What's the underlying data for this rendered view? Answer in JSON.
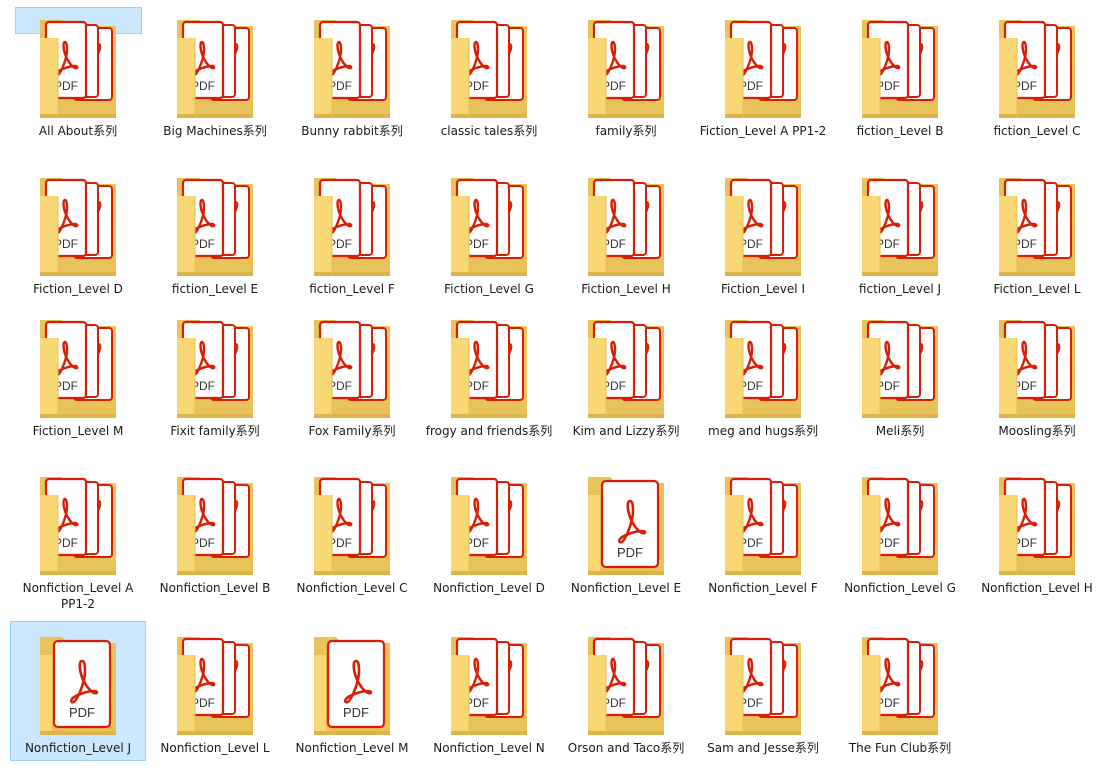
{
  "accent_color": "#cce8ff",
  "accent_border": "#99d1ff",
  "rows": [
    [
      {
        "label": "All About系列",
        "icon": "folder-pdf-icon",
        "state": "partial"
      },
      {
        "label": "Big Machines系列",
        "icon": "folder-pdf-icon"
      },
      {
        "label": "Bunny rabbit系列",
        "icon": "folder-pdf-icon"
      },
      {
        "label": "classic tales系列",
        "icon": "folder-pdf-icon"
      },
      {
        "label": "family系列",
        "icon": "folder-pdf-icon"
      },
      {
        "label": "Fiction_Level A PP1-2",
        "icon": "folder-pdf-icon"
      },
      {
        "label": "fiction_Level B",
        "icon": "folder-pdf-icon"
      },
      {
        "label": "fiction_Level C",
        "icon": "folder-pdf-icon"
      }
    ],
    [
      {
        "label": "Fiction_Level D",
        "icon": "folder-pdf-icon"
      },
      {
        "label": "fiction_Level E",
        "icon": "folder-pdf-icon"
      },
      {
        "label": "fiction_Level F",
        "icon": "folder-pdf-icon"
      },
      {
        "label": "Fiction_Level G",
        "icon": "folder-pdf-icon"
      },
      {
        "label": "Fiction_Level H",
        "icon": "folder-pdf-icon"
      },
      {
        "label": "Fiction_Level I",
        "icon": "folder-pdf-icon"
      },
      {
        "label": "fiction_Level J",
        "icon": "folder-pdf-icon"
      },
      {
        "label": "Fiction_Level L",
        "icon": "folder-pdf-icon"
      }
    ],
    [
      {
        "label": "Fiction_Level M",
        "icon": "folder-pdf-icon"
      },
      {
        "label": "Fixit family系列",
        "icon": "folder-pdf-icon"
      },
      {
        "label": "Fox Family系列",
        "icon": "folder-pdf-icon"
      },
      {
        "label": "frogy and friends系列",
        "icon": "folder-pdf-icon"
      },
      {
        "label": "Kim and Lizzy系列",
        "icon": "folder-pdf-icon"
      },
      {
        "label": "meg and hugs系列",
        "icon": "folder-pdf-icon"
      },
      {
        "label": "Meli系列",
        "icon": "folder-pdf-icon"
      },
      {
        "label": "Moosling系列",
        "icon": "folder-pdf-icon"
      }
    ],
    [
      {
        "label": "Nonfiction_Level A PP1-2",
        "icon": "folder-pdf-icon"
      },
      {
        "label": "Nonfiction_Level B",
        "icon": "folder-pdf-icon"
      },
      {
        "label": "Nonfiction_Level C",
        "icon": "folder-pdf-icon"
      },
      {
        "label": "Nonfiction_Level D",
        "icon": "folder-pdf-icon"
      },
      {
        "label": "Nonfiction_Level E",
        "icon": "folder-single-pdf-icon"
      },
      {
        "label": "Nonfiction_Level F",
        "icon": "folder-pdf-icon"
      },
      {
        "label": "Nonfiction_Level G",
        "icon": "folder-pdf-icon"
      },
      {
        "label": "Nonfiction_Level H",
        "icon": "folder-pdf-icon"
      }
    ],
    [
      {
        "label": "Nonfiction_Level J",
        "icon": "folder-single-pdf-icon",
        "state": "selected"
      },
      {
        "label": "Nonfiction_Level L",
        "icon": "folder-pdf-icon"
      },
      {
        "label": "Nonfiction_Level M",
        "icon": "folder-single-pdf-icon"
      },
      {
        "label": "Nonfiction_Level N",
        "icon": "folder-pdf-icon"
      },
      {
        "label": "Orson and Taco系列",
        "icon": "folder-pdf-icon"
      },
      {
        "label": "Sam and Jesse系列",
        "icon": "folder-pdf-icon"
      },
      {
        "label": "The Fun Club系列",
        "icon": "folder-pdf-icon"
      }
    ]
  ],
  "icon_text": "PDF"
}
